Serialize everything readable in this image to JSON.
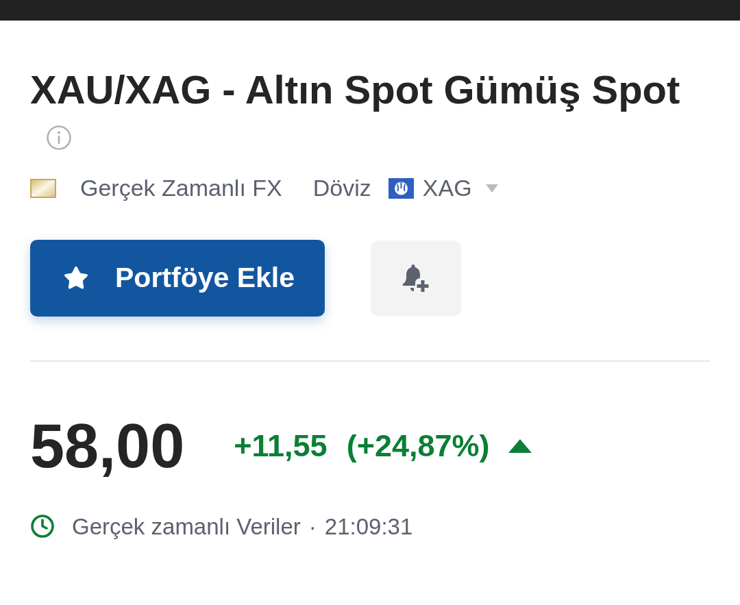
{
  "title": "XAU/XAG - Altın Spot Gümüş Spot",
  "meta": {
    "exchange": "Gerçek Zamanlı FX",
    "type": "Döviz",
    "currency": "XAG"
  },
  "actions": {
    "portfolio_button": "Portföye Ekle"
  },
  "quote": {
    "price": "58,00",
    "change": "+11,55",
    "change_percent": "(+24,87%)",
    "rising": true
  },
  "data_note": {
    "label": "Gerçek zamanlı Veriler",
    "separator": "·",
    "time": "21:09:31"
  }
}
